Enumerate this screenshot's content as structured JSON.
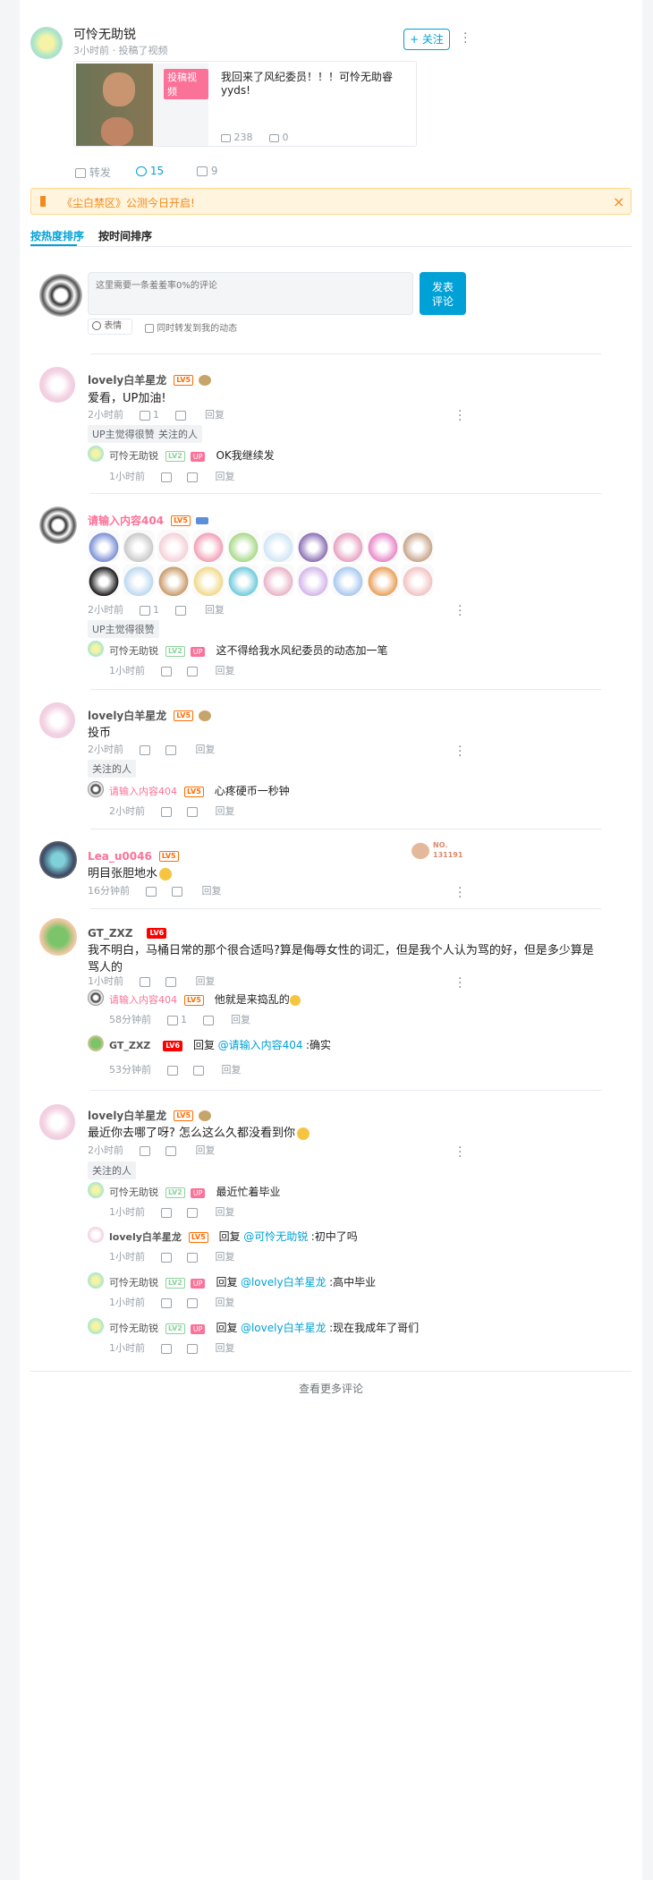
{
  "header": {
    "username": "可怜无助锐",
    "meta": "3小时前 · 投稿了视频",
    "follow_label": "+ 关注"
  },
  "video": {
    "thumb_badge": "投稿视频",
    "text": "我回来了风纪委员！！！可怜无助睿yyds!",
    "views": "238",
    "danmaku": "0"
  },
  "actions": {
    "share": "转发",
    "comment": "15",
    "like": "9"
  },
  "notice": {
    "text": "《尘白禁区》公测今日开启!"
  },
  "sort": {
    "hot": "按热度排序",
    "time": "按时间排序"
  },
  "composer": {
    "placeholder": "这里需要一条羞羞率0%的评论",
    "emoji": "表情",
    "forward": "同时转发到我的动态",
    "submit1": "发表",
    "submit2": "评论"
  },
  "common": {
    "reply": "回复",
    "lv5": "LV5",
    "lv2": "LV2",
    "lv6": "LV6",
    "up": "UP"
  },
  "comments": [
    {
      "user": "lovely白羊星龙",
      "text": "爱看，UP加油!",
      "time": "2小时前",
      "likes": "1",
      "tags": [
        "UP主觉得很赞",
        "关注的人"
      ],
      "replies": [
        {
          "user": "可怜无助锐",
          "text": "OK我继续发",
          "time": "1小时前"
        }
      ]
    },
    {
      "user": "请输入内容404",
      "time": "2小时前",
      "likes": "1",
      "tags": [
        "UP主觉得很赞"
      ],
      "replies": [
        {
          "user": "可怜无助锐",
          "text": "这不得给我水风纪委员的动态加一笔",
          "time": "1小时前"
        }
      ]
    },
    {
      "user": "lovely白羊星龙",
      "text": "投币",
      "time": "2小时前",
      "tags": [
        "关注的人"
      ],
      "replies": [
        {
          "user": "请输入内容404",
          "text": "心疼硬币一秒钟",
          "time": "2小时前"
        }
      ]
    },
    {
      "user": "Lea_u0046",
      "text": "明目张胆地水",
      "time": "16分钟前",
      "badge1": "NO.",
      "badge2": "131191"
    },
    {
      "user": "GT_ZXZ",
      "text": "我不明白，马桶日常的那个很合适吗?算是侮辱女性的词汇，但是我个人认为骂的好，但是多少算是骂人的",
      "time": "1小时前",
      "replies": [
        {
          "user": "请输入内容404",
          "text": "他就是来捣乱的",
          "time": "58分钟前",
          "likes": "1"
        },
        {
          "user": "GT_ZXZ",
          "prefix": "回复",
          "at": "@请输入内容404",
          "text": ":确实",
          "time": "53分钟前"
        }
      ]
    },
    {
      "user": "lovely白羊星龙",
      "text": "最近你去哪了呀? 怎么这么久都没看到你",
      "time": "2小时前",
      "tags": [
        "关注的人"
      ],
      "replies": [
        {
          "user": "可怜无助锐",
          "text": "最近忙着毕业",
          "time": "1小时前"
        },
        {
          "user": "lovely白羊星龙",
          "prefix": "回复",
          "at": "@可怜无助锐",
          "text": ":初中了吗",
          "time": "1小时前"
        },
        {
          "user": "可怜无助锐",
          "prefix": "回复",
          "at": "@lovely白羊星龙",
          "text": ":高中毕业",
          "time": "1小时前"
        },
        {
          "user": "可怜无助锐",
          "prefix": "回复",
          "at": "@lovely白羊星龙",
          "text": ":现在我成年了哥们",
          "time": "1小时前"
        }
      ]
    }
  ],
  "footer": {
    "more": "查看更多评论"
  },
  "emoji_colors": [
    "#7b8fd6",
    "#c9c9c9",
    "#f5d0d8",
    "#f3a0b7",
    "#a8d98a",
    "#cfe6f5",
    "#8b6fb5",
    "#e8a1c0",
    "#e887c8",
    "#c8a58b",
    "#1a1a1a",
    "#bcd8f0",
    "#c99a6a",
    "#f0d98a",
    "#6ecbdc",
    "#e9b3c7",
    "#d3b6ea",
    "#a8c7ef",
    "#e9a05a",
    "#f2c3c3"
  ]
}
